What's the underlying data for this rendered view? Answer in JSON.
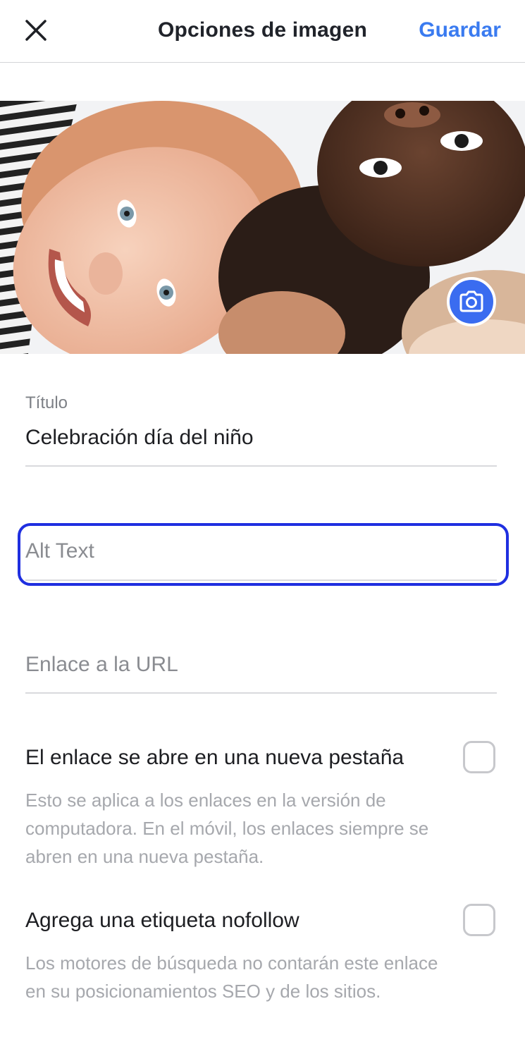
{
  "header": {
    "title": "Opciones de imagen",
    "save_label": "Guardar",
    "close_icon": "close-icon"
  },
  "image": {
    "camera_icon": "camera-icon",
    "accent_color": "#3a6cf0"
  },
  "title_field": {
    "label": "Título",
    "value": "Celebración día del niño"
  },
  "alt_field": {
    "placeholder": "Alt Text",
    "value": ""
  },
  "url_field": {
    "placeholder": "Enlace a la URL",
    "value": ""
  },
  "options": [
    {
      "label": "El enlace se abre en una nueva pestaña",
      "checked": false,
      "description_lines": [
        "Esto se aplica a los enlaces en la versión de",
        "computadora. En el móvil, los enlaces siempre se",
        "abren en una nueva pestaña."
      ]
    },
    {
      "label": "Agrega una etiqueta nofollow",
      "checked": false,
      "description_lines": [
        "Los motores de búsqueda no contarán este enlace",
        "en su posicionamientos SEO y de los sitios."
      ]
    }
  ],
  "colors": {
    "accent": "#3a7bf0",
    "focus_border": "#1f2fe0"
  }
}
